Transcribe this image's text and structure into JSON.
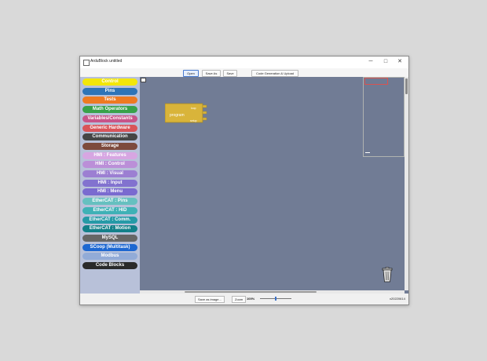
{
  "window": {
    "title": "ArduBlock untitled"
  },
  "controls": {
    "minimize": "─",
    "maximize": "□",
    "close": "✕"
  },
  "toolbar": {
    "open": "Open",
    "save_as": "Save As",
    "save": "Save",
    "upload": "Code Generation & Upload"
  },
  "categories": [
    {
      "label": "Control",
      "color": "#f2e60a"
    },
    {
      "label": "Pins",
      "color": "#2e74b7"
    },
    {
      "label": "Tests",
      "color": "#ee7a22"
    },
    {
      "label": "Math Operators",
      "color": "#38a24a"
    },
    {
      "label": "Variables/Constants",
      "color": "#c8548a"
    },
    {
      "label": "Generic Hardware",
      "color": "#d9545a"
    },
    {
      "label": "Communication",
      "color": "#464646"
    },
    {
      "label": "Storage",
      "color": "#7d4a3d"
    },
    {
      "label": "HMI : Features",
      "color": "#d7a6e2"
    },
    {
      "label": "HMI : Control",
      "color": "#bb8fd8"
    },
    {
      "label": "HMI : Visual",
      "color": "#9c7fd2"
    },
    {
      "label": "HMI : Input",
      "color": "#8272cf"
    },
    {
      "label": "HMI : Menu",
      "color": "#7a6ad0"
    },
    {
      "label": "EtherCAT : Pins",
      "color": "#66c0c0"
    },
    {
      "label": "EtherCAT : HID",
      "color": "#3fb1b6"
    },
    {
      "label": "EtherCAT : Comm.",
      "color": "#269aa7"
    },
    {
      "label": "EtherCAT : Motion",
      "color": "#138089"
    },
    {
      "label": "MySQL",
      "color": "#666666"
    },
    {
      "label": "SCoop (Multitask)",
      "color": "#1d67d1"
    },
    {
      "label": "Modbus",
      "color": "#92abd7"
    },
    {
      "label": "Code Blocks",
      "color": "#2a2a2a"
    }
  ],
  "block": {
    "label": "program",
    "slot_top": "loop",
    "slot_bottom": "setup"
  },
  "bottom": {
    "save_image": "Save as image...",
    "zoom_label": "Zoom",
    "zoom_value": "100%",
    "zoom_level": 0.5,
    "version": "v20220614"
  },
  "colors": {
    "canvas": "#717c95",
    "palette": "#b8c1d9",
    "block": "#d9b43a",
    "minimap_view": "#d9534f"
  }
}
